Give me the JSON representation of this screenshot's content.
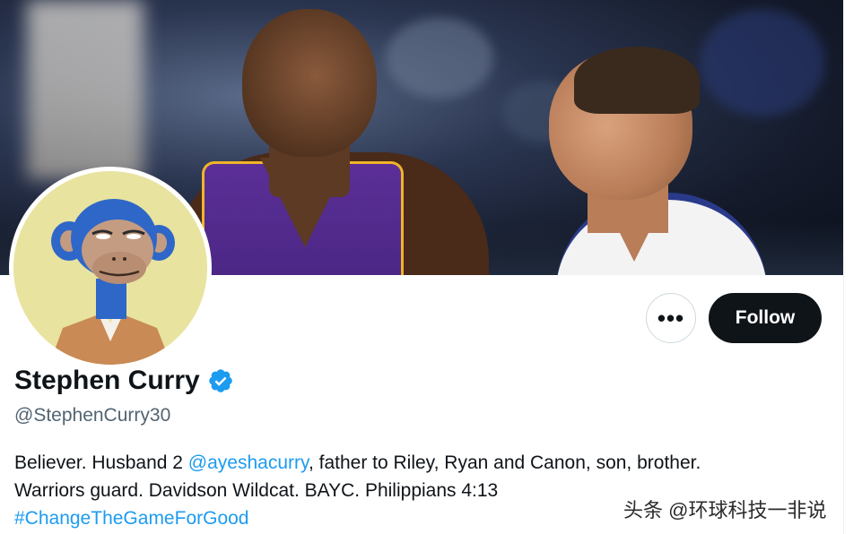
{
  "profile": {
    "display_name": "Stephen Curry",
    "handle": "@StephenCurry30",
    "verified": true,
    "verified_icon": "verified-badge-icon",
    "accent_color": "#1d9bf0",
    "bio": {
      "line1_text_a": "Believer. Husband 2 ",
      "line1_mention": "@ayeshacurry",
      "line1_text_b": ", father to Riley, Ryan and Canon, son, brother.",
      "line2": "Warriors guard. Davidson Wildcat. BAYC. Philippians 4:13",
      "hashtag": "#ChangeTheGameForGood"
    }
  },
  "actions": {
    "more_label": "•••",
    "follow_label": "Follow"
  },
  "watermark": "头条 @环球科技一非说"
}
